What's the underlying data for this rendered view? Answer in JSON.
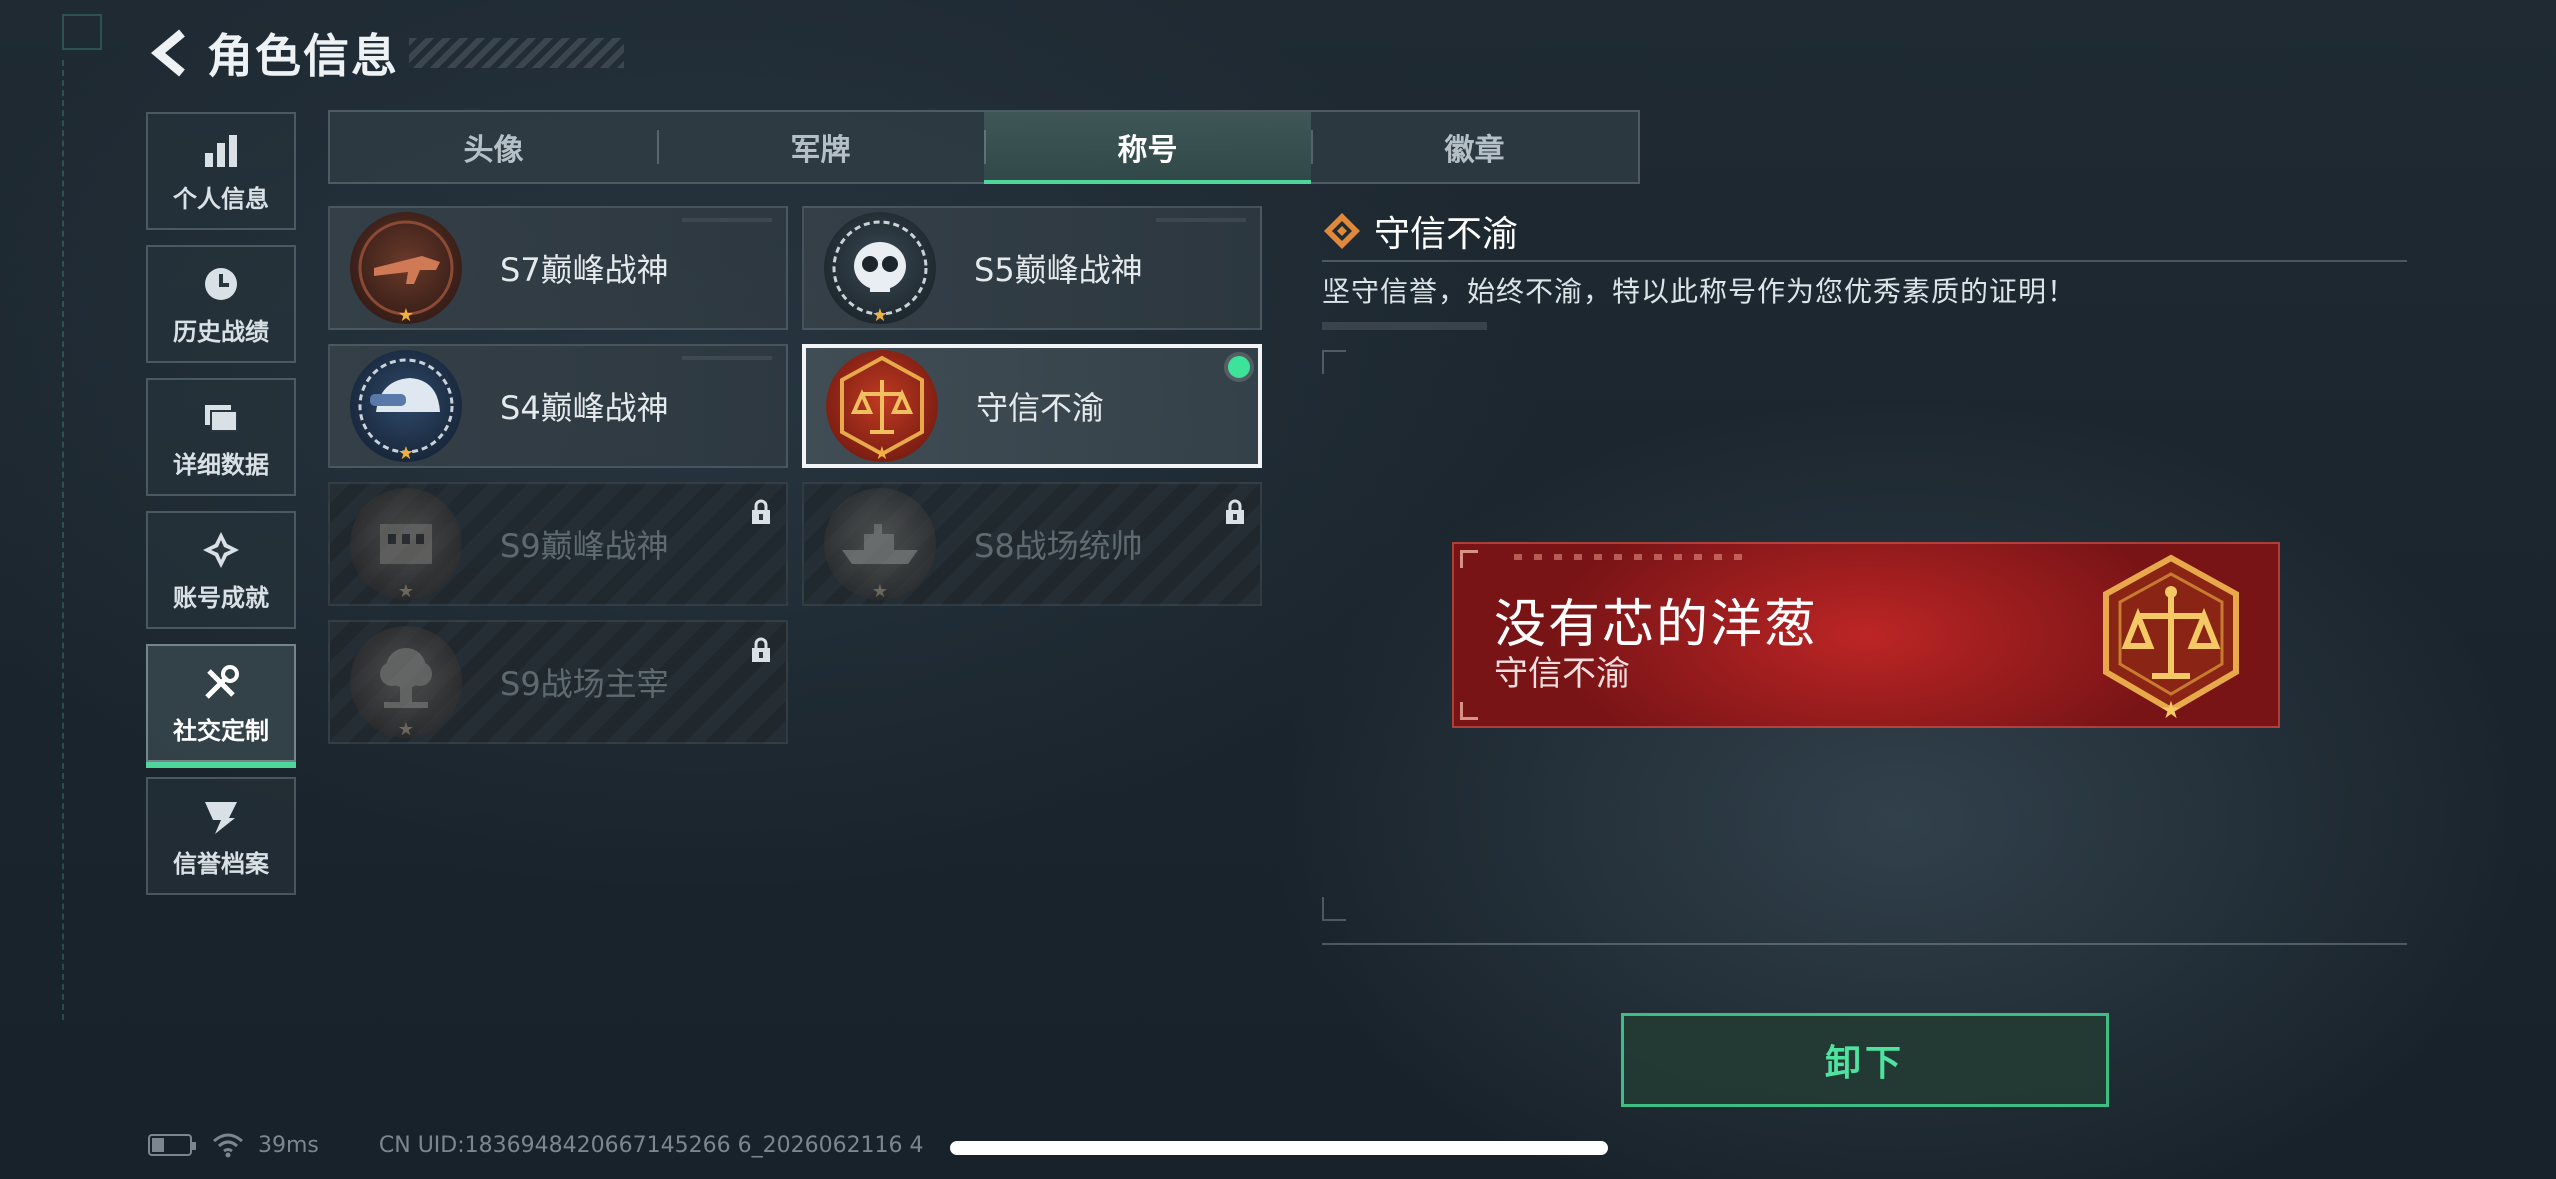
{
  "header": {
    "title": "角色信息"
  },
  "sidebar": {
    "items": [
      {
        "label": "个人信息",
        "icon": "bar-chart-icon"
      },
      {
        "label": "历史战绩",
        "icon": "clock-icon"
      },
      {
        "label": "详细数据",
        "icon": "folder-icon"
      },
      {
        "label": "账号成就",
        "icon": "achievement-icon"
      },
      {
        "label": "社交定制",
        "icon": "tools-icon",
        "active": true
      },
      {
        "label": "信誉档案",
        "icon": "reputation-icon"
      }
    ]
  },
  "tabs": [
    {
      "label": "头像"
    },
    {
      "label": "军牌"
    },
    {
      "label": "称号",
      "active": true
    },
    {
      "label": "徽章"
    }
  ],
  "titles": [
    {
      "name": "S7巅峰战神",
      "locked": false
    },
    {
      "name": "S5巅峰战神",
      "locked": false
    },
    {
      "name": "S4巅峰战神",
      "locked": false
    },
    {
      "name": "守信不渝",
      "locked": false,
      "selected": true,
      "equipped": true
    },
    {
      "name": "S9巅峰战神",
      "locked": true
    },
    {
      "name": "S8战场统帅",
      "locked": true
    },
    {
      "name": "S9战场主宰",
      "locked": true
    }
  ],
  "detail": {
    "title": "守信不渝",
    "description": "坚守信誉，始终不渝，特以此称号作为您优秀素质的证明！"
  },
  "nameplate": {
    "player_name": "没有芯的洋葱",
    "title": "守信不渝"
  },
  "actions": {
    "unequip_label": "卸下"
  },
  "status": {
    "ping": "39ms",
    "uid": "CN UID:1836948420667145266 6_2026062116 4"
  },
  "colors": {
    "accent_green": "#4fd69a",
    "button_text_green": "#4fe3a0",
    "equipped_dot": "#3ee39a",
    "nameplate_red": "#b41e22",
    "badge_gold": "#f0b23a"
  }
}
